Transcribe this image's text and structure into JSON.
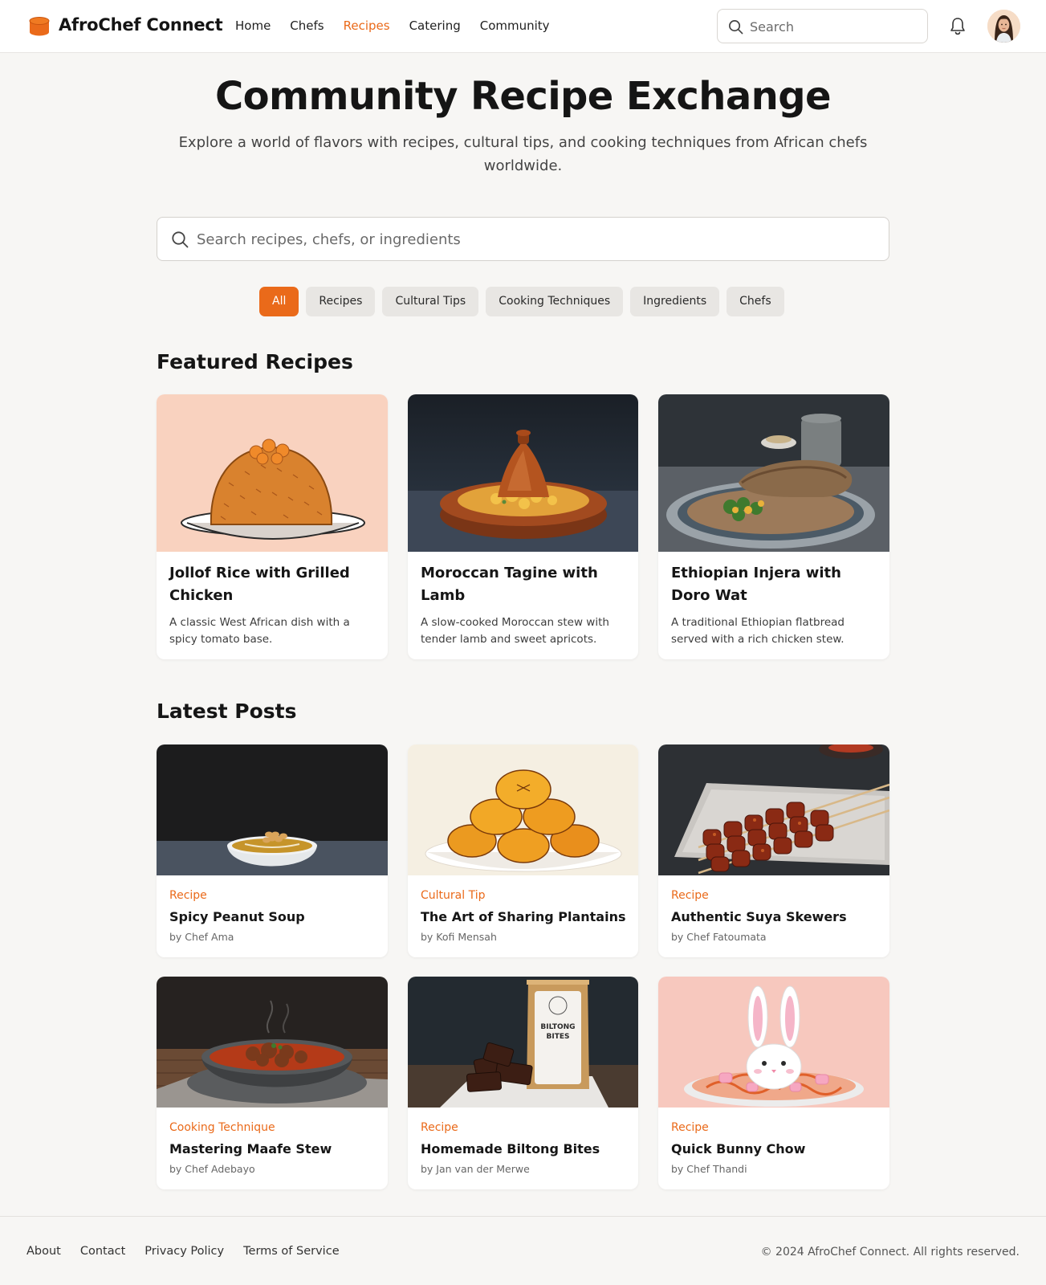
{
  "brand": {
    "name": "AfroChef Connect",
    "accent": "#ea6a1a",
    "logo_icon": "drum-icon"
  },
  "nav": {
    "items": [
      "Home",
      "Chefs",
      "Recipes",
      "Catering",
      "Community"
    ],
    "active": "Recipes"
  },
  "top_search": {
    "placeholder": "Search",
    "icon": "search-icon"
  },
  "header_icons": {
    "notifications": "bell-icon",
    "avatar": "user-avatar"
  },
  "hero": {
    "title": "Community Recipe Exchange",
    "subtitle": "Explore a world of flavors with recipes, cultural tips, and cooking techniques from African chefs worldwide."
  },
  "main_search": {
    "placeholder": "Search recipes, chefs, or ingredients"
  },
  "filters": {
    "items": [
      "All",
      "Recipes",
      "Cultural Tips",
      "Cooking Techniques",
      "Ingredients",
      "Chefs"
    ],
    "active": "All"
  },
  "featured": {
    "title": "Featured Recipes",
    "cards": [
      {
        "title": "Jollof Rice with Grilled Chicken",
        "desc": "A classic West African dish with a spicy tomato base.",
        "image": "jollof-rice-image"
      },
      {
        "title": "Moroccan Tagine with Lamb",
        "desc": "A slow-cooked Moroccan stew with tender lamb and sweet apricots.",
        "image": "tagine-image"
      },
      {
        "title": "Ethiopian Injera with Doro Wat",
        "desc": "A traditional Ethiopian flatbread served with a rich chicken stew.",
        "image": "injera-image"
      }
    ]
  },
  "latest": {
    "title": "Latest Posts",
    "posts": [
      {
        "category": "Recipe",
        "title": "Spicy Peanut Soup",
        "author": "by Chef Ama",
        "image": "peanut-soup-image"
      },
      {
        "category": "Cultural Tip",
        "title": "The Art of Sharing Plantains",
        "author": "by Kofi Mensah",
        "image": "plantains-image"
      },
      {
        "category": "Recipe",
        "title": "Authentic Suya Skewers",
        "author": "by Chef Fatoumata",
        "image": "suya-image"
      },
      {
        "category": "Cooking Technique",
        "title": "Mastering Maafe Stew",
        "author": "by Chef Adebayo",
        "image": "maafe-image"
      },
      {
        "category": "Recipe",
        "title": "Homemade Biltong Bites",
        "author": "by Jan van der Merwe",
        "image": "biltong-image"
      },
      {
        "category": "Recipe",
        "title": "Quick Bunny Chow",
        "author": "by Chef Thandi",
        "image": "bunny-chow-image"
      }
    ],
    "biltong_package_text": [
      "BILTONG",
      "BITES"
    ]
  },
  "footer": {
    "links": [
      "About",
      "Contact",
      "Privacy Policy",
      "Terms of Service"
    ],
    "copyright": "© 2024 AfroChef Connect. All rights reserved."
  }
}
